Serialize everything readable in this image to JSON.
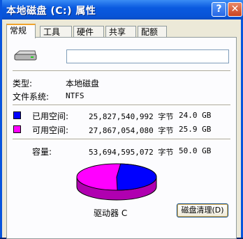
{
  "window": {
    "title": "本地磁盘 (C:) 属性",
    "help": "?",
    "close": "✕"
  },
  "tabs": [
    {
      "label": "常规",
      "active": true
    },
    {
      "label": "工具"
    },
    {
      "label": "硬件"
    },
    {
      "label": "共享"
    },
    {
      "label": "配额"
    }
  ],
  "general": {
    "name_value": "",
    "type_label": "类型:",
    "type_value": "本地磁盘",
    "fs_label": "文件系统:",
    "fs_value": "NTFS",
    "used": {
      "label": "已用空间:",
      "bytes": "25,827,540,992 字节",
      "size": "24.0 GB",
      "color": "#0000ff",
      "fraction": 0.481
    },
    "free": {
      "label": "可用空间:",
      "bytes": "27,867,054,080 字节",
      "size": "25.9 GB",
      "color": "#ff00ff",
      "fraction": 0.519
    },
    "capacity": {
      "label": "容量:",
      "bytes": "53,694,595,072 字节",
      "size": "50.0 GB"
    },
    "drive_label": "驱动器 C",
    "cleanup_button": "磁盘清理(D)"
  }
}
